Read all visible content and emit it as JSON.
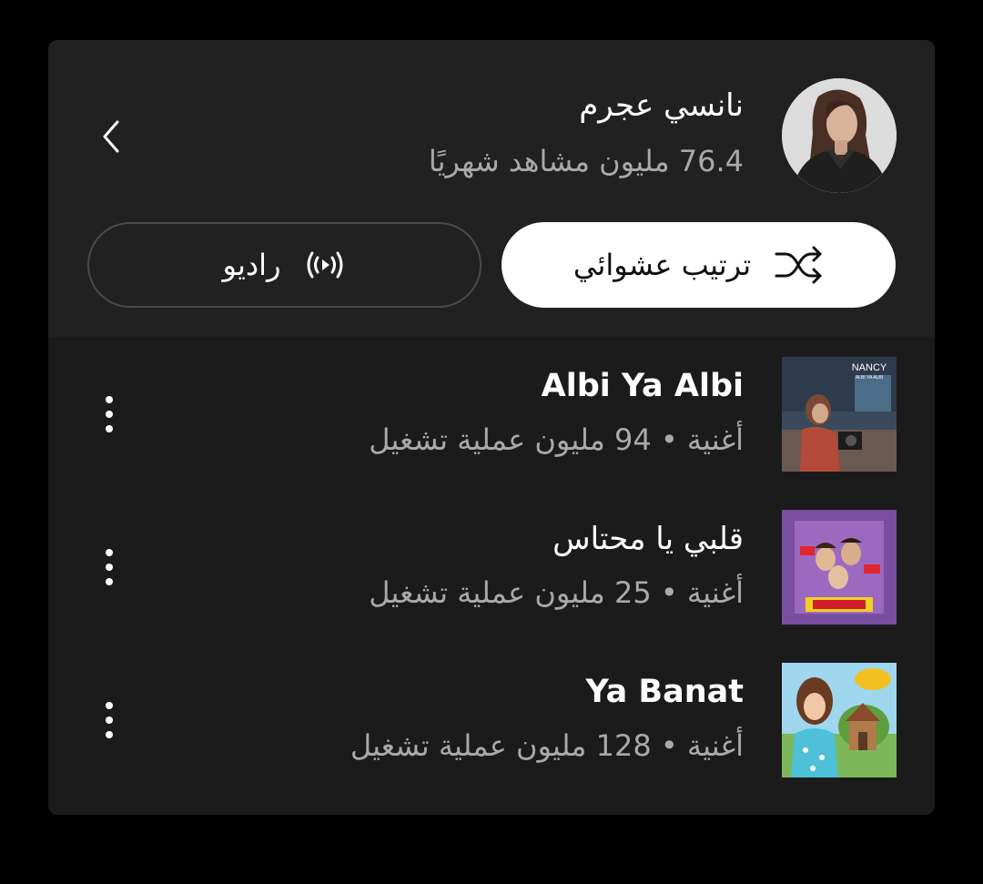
{
  "artist": {
    "name": "نانسي عجرم",
    "monthly_listeners": "76.4 مليون مشاهد شهريًا"
  },
  "actions": {
    "shuffle_label": "ترتيب عشوائي",
    "radio_label": "راديو"
  },
  "icons": {
    "back": "chevron-left-icon",
    "shuffle": "shuffle-icon",
    "radio": "radio-broadcast-icon",
    "more": "more-vertical-icon"
  },
  "songs": [
    {
      "title": "Albi Ya Albi",
      "subtitle": "أغنية • 94 مليون عملية تشغيل"
    },
    {
      "title": "قلبي يا محتاس",
      "subtitle": "أغنية • 25 مليون عملية تشغيل"
    },
    {
      "title": "Ya Banat",
      "subtitle": "أغنية • 128 مليون عملية تشغيل"
    }
  ],
  "colors": {
    "page_bg": "#000000",
    "card_bg": "#1b1b1b",
    "header_bg": "#212121",
    "primary_text": "#ffffff",
    "secondary_text": "#a9a9a9"
  }
}
